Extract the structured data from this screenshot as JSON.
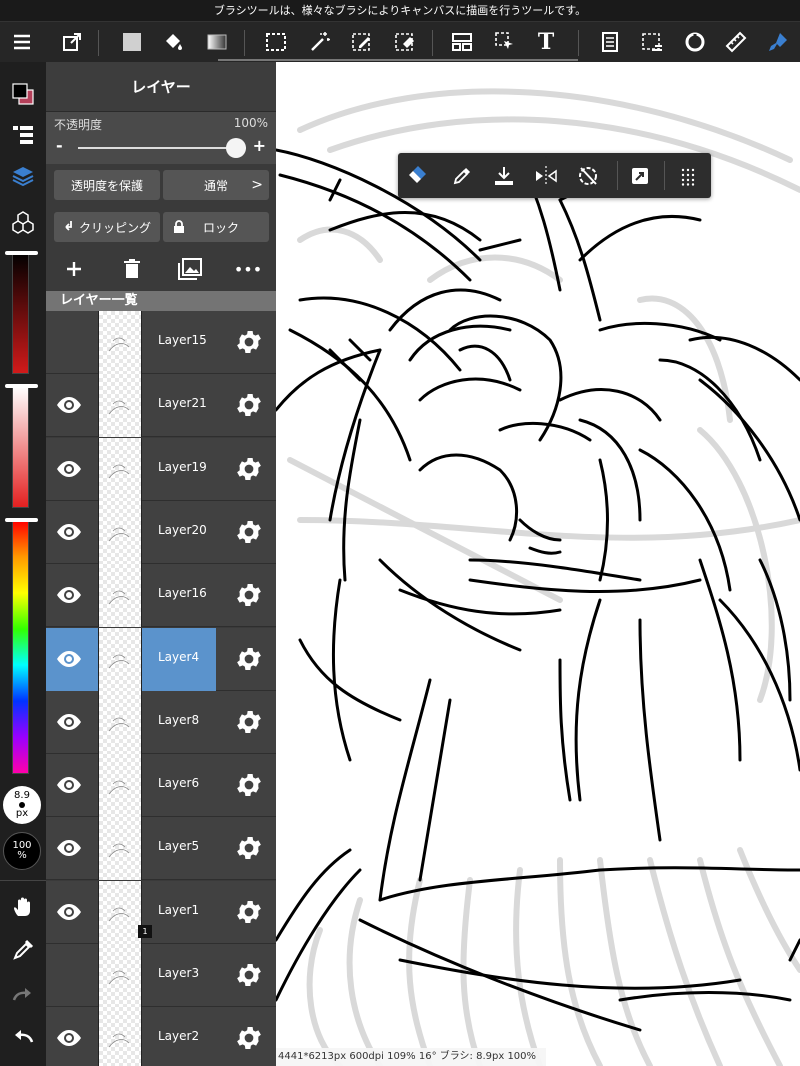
{
  "tip": "ブラシツールは、様々なブラシによりキャンバスに描画を行うツールです。",
  "toolbar": {
    "icons": [
      "menu-icon",
      "export-icon",
      "fill-color-icon",
      "bucket-icon",
      "gradient-icon",
      "select-rect-icon",
      "magic-wand-icon",
      "select-pen-icon",
      "select-eraser-icon",
      "layout-icon",
      "move-icon",
      "text-icon",
      "layers-list-icon",
      "deselect-icon",
      "rotate-icon",
      "ruler-icon",
      "brush-icon"
    ],
    "text_tool_label": "T",
    "active_color": "#3a7fd0"
  },
  "rail": {
    "brush_size": "8.9",
    "brush_unit": "px",
    "opacity_value": "100",
    "opacity_unit": "%"
  },
  "panel": {
    "title": "レイヤー",
    "opacity_label": "不透明度",
    "opacity_value": "100%",
    "opacity_level": 1.0,
    "minus": "-",
    "plus": "+",
    "protect_alpha": "透明度を保護",
    "blend_mode": "通常",
    "blend_arrow": ">",
    "clipping": "クリッピング",
    "lock": "ロック",
    "list_header": "レイヤー一覧",
    "more": "•••",
    "layers": [
      {
        "name": "Layer15",
        "visible": false,
        "selected": false
      },
      {
        "name": "Layer21",
        "visible": true,
        "selected": false
      },
      {
        "name": "Layer19",
        "visible": true,
        "selected": false
      },
      {
        "name": "Layer20",
        "visible": true,
        "selected": false
      },
      {
        "name": "Layer16",
        "visible": true,
        "selected": false
      },
      {
        "name": "Layer4",
        "visible": true,
        "selected": true
      },
      {
        "name": "Layer8",
        "visible": true,
        "selected": false
      },
      {
        "name": "Layer6",
        "visible": true,
        "selected": false
      },
      {
        "name": "Layer5",
        "visible": true,
        "selected": false
      },
      {
        "name": "Layer1",
        "visible": true,
        "selected": false
      },
      {
        "name": "Layer3",
        "visible": false,
        "selected": false
      },
      {
        "name": "Layer2",
        "visible": true,
        "selected": false
      }
    ],
    "layer1_badge": "1",
    "selected_color": "#5b93cc"
  },
  "float_toolbar": [
    "brush-eraser-icon",
    "eyedropper-icon",
    "transfer-down-icon",
    "flip-icon",
    "rotate-reset-icon",
    "transform-icon",
    "grid-icon"
  ],
  "status": "4441*6213px 600dpi 109% 16° ブラシ: 8.9px 100%"
}
